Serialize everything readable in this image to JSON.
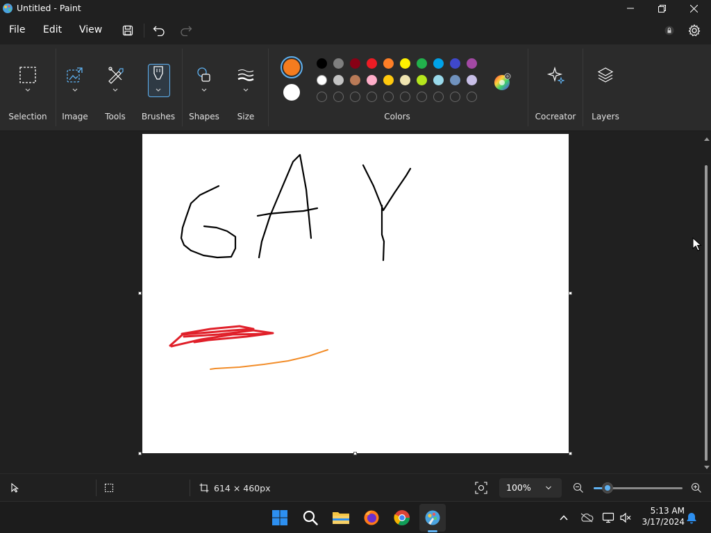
{
  "window": {
    "title": "Untitled - Paint"
  },
  "menu": {
    "file": "File",
    "edit": "Edit",
    "view": "View"
  },
  "ribbon": {
    "selection": "Selection",
    "image": "Image",
    "tools": "Tools",
    "brushes": "Brushes",
    "shapes": "Shapes",
    "size": "Size",
    "colors": "Colors",
    "cocreator": "Cocreator",
    "layers": "Layers",
    "primary_color": "#f47c1f",
    "secondary_color": "#ffffff",
    "palette_row1": [
      "#000000",
      "#7f7f7f",
      "#880015",
      "#ed1c24",
      "#ff7f27",
      "#fff200",
      "#22b14c",
      "#00a2e8",
      "#3f48cc",
      "#a349a4"
    ],
    "palette_row2": [
      "#ffffff",
      "#c3c3c3",
      "#b97a57",
      "#ffaec9",
      "#ffc90e",
      "#efe4b0",
      "#b5e61d",
      "#99d9ea",
      "#7092be",
      "#c8bfe7"
    ]
  },
  "canvas": {
    "drawn_text": "GAY"
  },
  "status": {
    "dimensions": "614 × 460px",
    "zoom": "100%"
  },
  "taskbar": {
    "time": "5:13 AM",
    "date": "3/17/2024"
  }
}
